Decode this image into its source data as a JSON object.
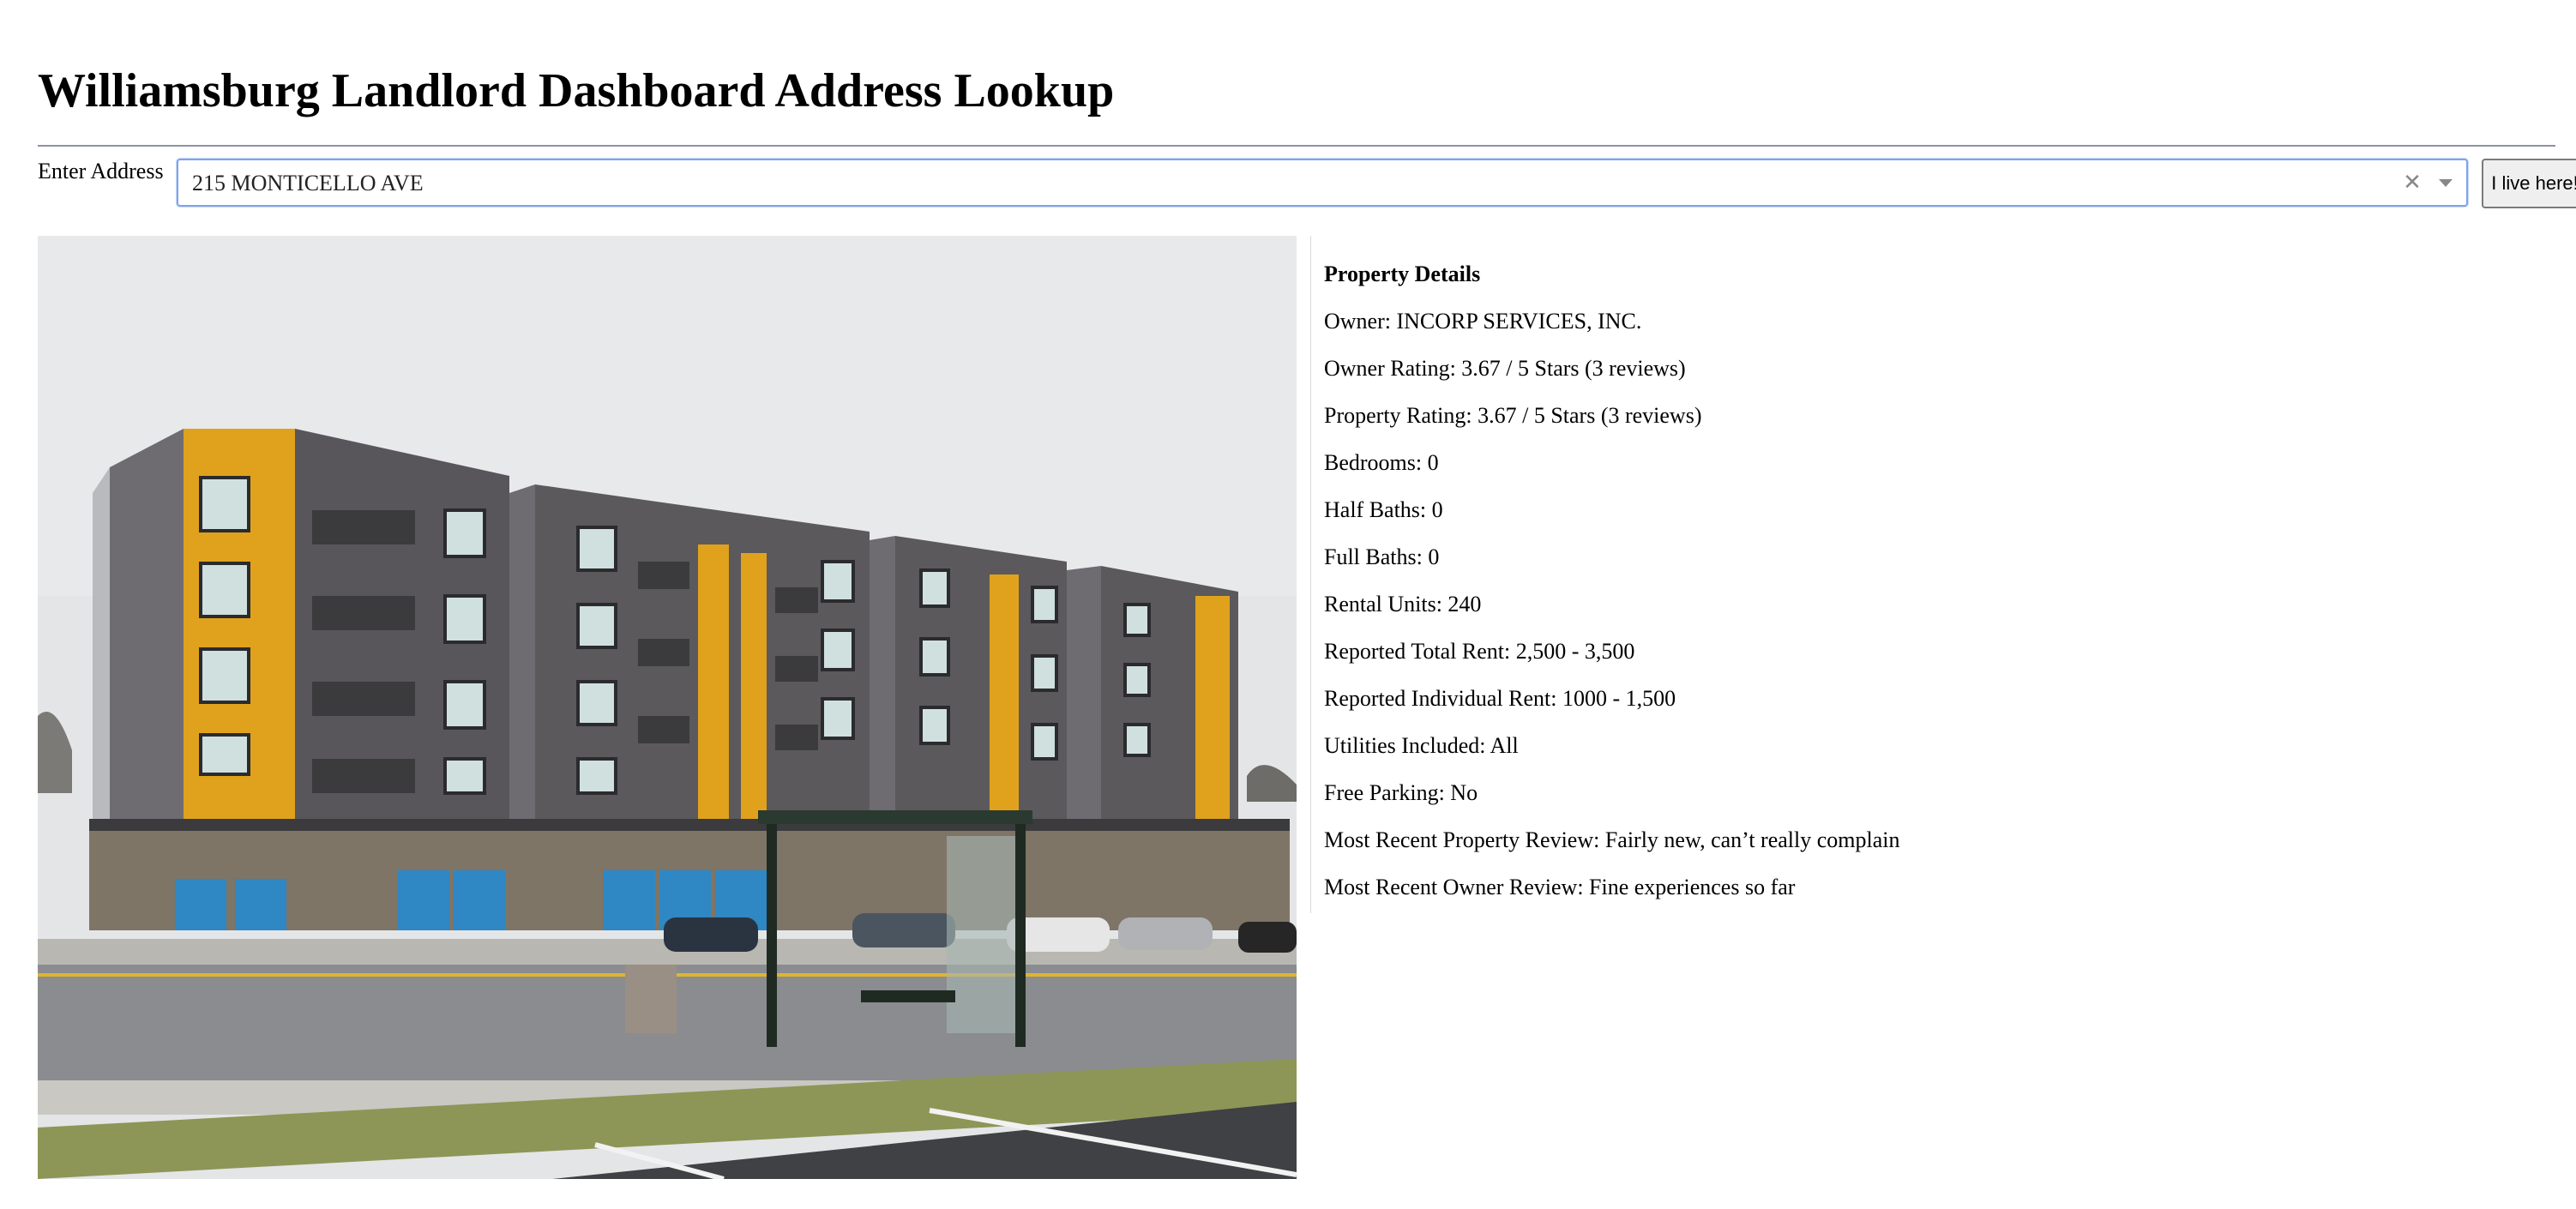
{
  "header": {
    "title": "Williamsburg Landlord Dashboard Address Lookup"
  },
  "address": {
    "label": "Enter Address",
    "value": "215 MONTICELLO AVE",
    "clear_icon": "close-icon",
    "dropdown_icon": "chevron-down-icon",
    "live_button_label": "I live here!"
  },
  "photo": {
    "alt": "Apartment building photo",
    "colors": {
      "sky": "#e4e5e7",
      "building_gray": "#5a575a",
      "accent_orange": "#e0a21d",
      "road": "#8a8c8f",
      "grass": "#8d9656"
    }
  },
  "details": {
    "heading": "Property Details",
    "owner": "Owner: INCORP SERVICES, INC.",
    "owner_rating": "Owner Rating: 3.67 / 5 Stars (3 reviews)",
    "property_rating": "Property Rating: 3.67 / 5 Stars (3 reviews)",
    "bedrooms": "Bedrooms: 0",
    "half_baths": "Half Baths: 0",
    "full_baths": "Full Baths: 0",
    "rental_units": "Rental Units: 240",
    "total_rent": "Reported Total Rent: 2,500 - 3,500",
    "individual_rent": "Reported Individual Rent: 1000 - 1,500",
    "utilities": "Utilities Included: All",
    "parking": "Free Parking: No",
    "property_review": "Most Recent Property Review: Fairly new, can’t really complain",
    "owner_review": "Most Recent Owner Review: Fine experiences so far"
  }
}
